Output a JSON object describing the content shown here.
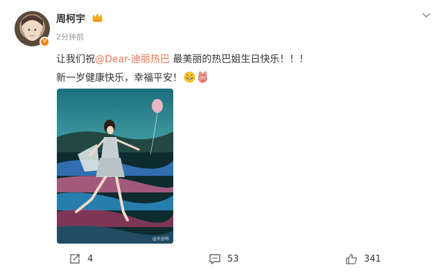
{
  "post": {
    "author": "周柯宇",
    "time": "2分钟前",
    "content": {
      "line1_prefix": "让我们祝",
      "mention": "@Dear-迪丽热巴",
      "line1_suffix": " 最美丽的热巴姐生日快乐！！！",
      "line2": "新一岁健康快乐，幸福平安！"
    },
    "image_watermark": "@大谷布",
    "actions": {
      "share_count": "4",
      "comment_count": "53",
      "like_count": "341"
    }
  },
  "icons": {
    "badge": "crown-badge-icon",
    "more": "chevron-down-icon",
    "share": "share-icon",
    "comment": "comment-icon",
    "like": "thumbs-up-icon",
    "emoji1": "grin-emoji-icon",
    "emoji2": "bunny-emoji-icon"
  },
  "colors": {
    "mention": "#eb7350",
    "verified": "#ff8200",
    "time": "#939393"
  }
}
